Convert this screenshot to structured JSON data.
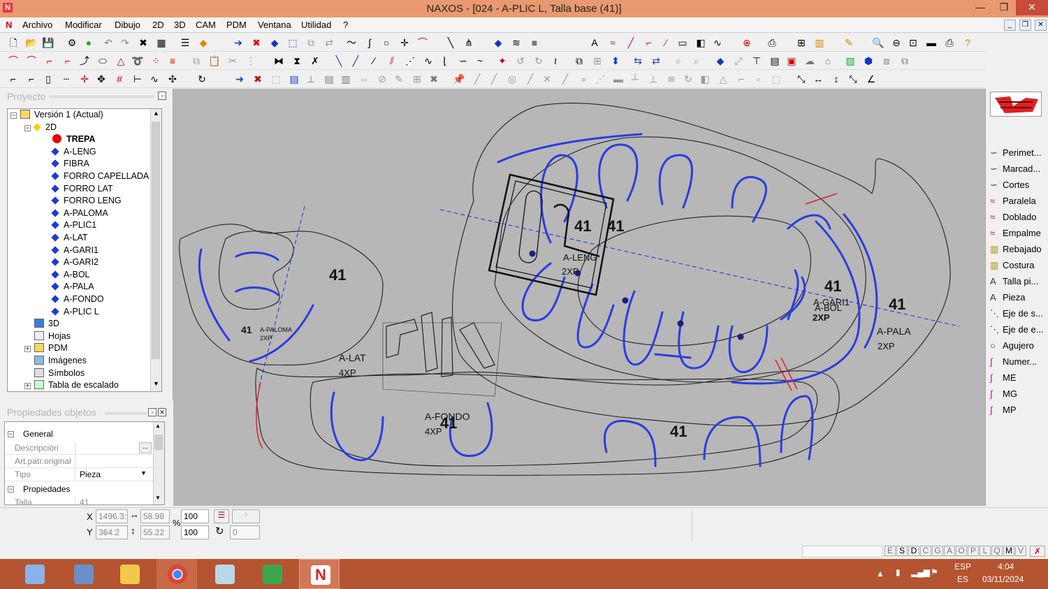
{
  "window": {
    "title": "NAXOS - [024 - A-PLIC L, Talla base (41)]",
    "controls": {
      "minimize": "—",
      "maximize": "❐",
      "close": "✕"
    }
  },
  "menu": {
    "items": [
      "Archivo",
      "Modificar",
      "Dibujo",
      "2D",
      "3D",
      "CAM",
      "PDM",
      "Ventana",
      "Utilidad",
      "?"
    ]
  },
  "project_panel": {
    "header": "Proyecto",
    "tree": [
      {
        "label": "Versión 1 (Actual)",
        "level": 0,
        "icon": "version-icon",
        "expanded": true
      },
      {
        "label": "2D",
        "level": 1,
        "icon": "2d-icon",
        "expanded": true
      },
      {
        "label": "TREPA",
        "level": 2,
        "icon": "red-dot-icon",
        "active": true
      },
      {
        "label": "A-LENG",
        "level": 2,
        "icon": "diamond-icon"
      },
      {
        "label": "FIBRA",
        "level": 2,
        "icon": "diamond-icon"
      },
      {
        "label": "FORRO CAPELLADA",
        "level": 2,
        "icon": "diamond-icon"
      },
      {
        "label": "FORRO LAT",
        "level": 2,
        "icon": "diamond-icon"
      },
      {
        "label": "FORRO LENG",
        "level": 2,
        "icon": "diamond-icon"
      },
      {
        "label": "A-PALOMA",
        "level": 2,
        "icon": "diamond-icon"
      },
      {
        "label": "A-PLIC1",
        "level": 2,
        "icon": "diamond-icon"
      },
      {
        "label": "A-LAT",
        "level": 2,
        "icon": "diamond-icon"
      },
      {
        "label": "A-GARI1",
        "level": 2,
        "icon": "diamond-icon"
      },
      {
        "label": "A-GARI2",
        "level": 2,
        "icon": "diamond-icon"
      },
      {
        "label": "A-BOL",
        "level": 2,
        "icon": "diamond-icon"
      },
      {
        "label": "A-PALA",
        "level": 2,
        "icon": "diamond-icon"
      },
      {
        "label": "A-FONDO",
        "level": 2,
        "icon": "diamond-icon"
      },
      {
        "label": "A-PLIC L",
        "level": 2,
        "icon": "diamond-icon"
      },
      {
        "label": "3D",
        "level": 1,
        "icon": "3d-icon"
      },
      {
        "label": "Hojas",
        "level": 1,
        "icon": "sheets-icon"
      },
      {
        "label": "PDM",
        "level": 1,
        "icon": "folder-icon",
        "expandable": true
      },
      {
        "label": "Imágenes",
        "level": 1,
        "icon": "images-icon"
      },
      {
        "label": "Símbolos",
        "level": 1,
        "icon": "symbols-icon"
      },
      {
        "label": "Tabla de escalado",
        "level": 1,
        "icon": "table-icon",
        "expandable": true
      }
    ]
  },
  "properties_panel": {
    "header": "Propiedades objetos",
    "group_general": "General",
    "rows": [
      {
        "label": "Descripción",
        "value": "",
        "button": "..."
      },
      {
        "label": "Art.patr.original",
        "value": ""
      },
      {
        "label": "Tipo",
        "value": "Pieza",
        "dropdown": true
      }
    ],
    "group_props": "Propiedades",
    "talla_label": "Talla",
    "talla_value": "41"
  },
  "canvas": {
    "labels": [
      {
        "text": "41",
        "id": "lbl-41-lat"
      },
      {
        "text": "41",
        "id": "lbl-41-a"
      },
      {
        "text": "41",
        "id": "lbl-41-b"
      },
      {
        "text": "41",
        "id": "lbl-41-c"
      },
      {
        "text": "41",
        "id": "lbl-41-d"
      },
      {
        "text": "41",
        "id": "lbl-41-fondo"
      },
      {
        "text": "41",
        "id": "lbl-41-e"
      },
      {
        "text": "41",
        "id": "lbl-41-f"
      }
    ],
    "piece_names": {
      "a_leng": "A-LENG",
      "a_leng_qty": "2XP",
      "a_gari": "A-GARI1",
      "a_bol": "A-BOL",
      "a_bol_qty": "2XP",
      "a_pala": "A-PALA",
      "a_pala_qty": "2XP",
      "a_lat": "A-LAT",
      "a_lat_qty": "4XP",
      "a_fondo": "A-FONDO",
      "a_fondo_qty": "4XP",
      "a_paloma": "A-PALOMA",
      "a_paloma_qty": "2XP"
    }
  },
  "right_panel": {
    "items": [
      {
        "label": "Perimet...",
        "icon": "perimeter-icon"
      },
      {
        "label": "Marcad...",
        "icon": "marker-icon"
      },
      {
        "label": "Cortes",
        "icon": "cuts-icon"
      },
      {
        "label": "Paralela",
        "icon": "parallel-icon"
      },
      {
        "label": "Doblado",
        "icon": "fold-icon"
      },
      {
        "label": "Empalme",
        "icon": "splice-icon"
      },
      {
        "label": "Rebajado",
        "icon": "skive-icon"
      },
      {
        "label": "Costura",
        "icon": "seam-icon"
      },
      {
        "label": "Talla pi...",
        "icon": "size-text-icon"
      },
      {
        "label": "Pieza",
        "icon": "piece-text-icon"
      },
      {
        "label": "Eje de s...",
        "icon": "axis-icon"
      },
      {
        "label": "Eje de e...",
        "icon": "axis2-icon"
      },
      {
        "label": "Agujero",
        "icon": "hole-icon"
      },
      {
        "label": "Numer...",
        "icon": "number-icon"
      },
      {
        "label": "ME",
        "icon": "me-icon"
      },
      {
        "label": "MG",
        "icon": "mg-icon"
      },
      {
        "label": "MP",
        "icon": "mp-icon"
      }
    ]
  },
  "status": {
    "x_label": "X",
    "x_value": "1496.3:",
    "y_label": "Y",
    "y_value": "364.2",
    "w_value": "58.98",
    "h_value": "55.22",
    "pct_label": "%",
    "scale_x": "100",
    "scale_y": "100",
    "rotation": "0",
    "letters": [
      "E",
      "S",
      "D",
      "C",
      "G",
      "A",
      "O",
      "P",
      "L",
      "Q",
      "M",
      "V"
    ]
  },
  "taskbar": {
    "lang": "ESP",
    "lang2": "ES",
    "time": "4:04",
    "date": "03/11/2024"
  }
}
